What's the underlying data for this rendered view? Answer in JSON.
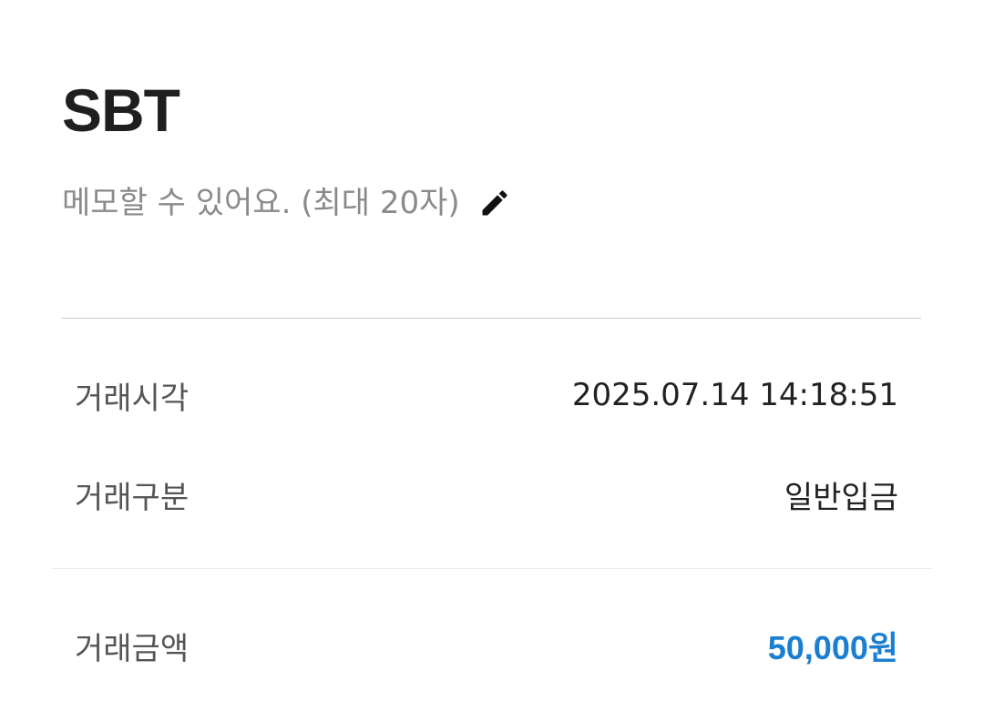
{
  "header": {
    "title": "SBT"
  },
  "memo": {
    "placeholder": "메모할 수 있어요. (최대 20자)",
    "edit_icon": "pencil-icon"
  },
  "details": {
    "rows": [
      {
        "label": "거래시각",
        "value": "2025.07.14 14:18:51"
      },
      {
        "label": "거래구분",
        "value": "일반입금"
      }
    ],
    "amount": {
      "label": "거래금액",
      "value": "50,000원",
      "color": "#1a7fd0"
    }
  },
  "colors": {
    "title": "#1f1f1f",
    "memo_text": "#8a8a8a",
    "label_text": "#555555",
    "value_text": "#222222",
    "accent": "#1a7fd0"
  }
}
